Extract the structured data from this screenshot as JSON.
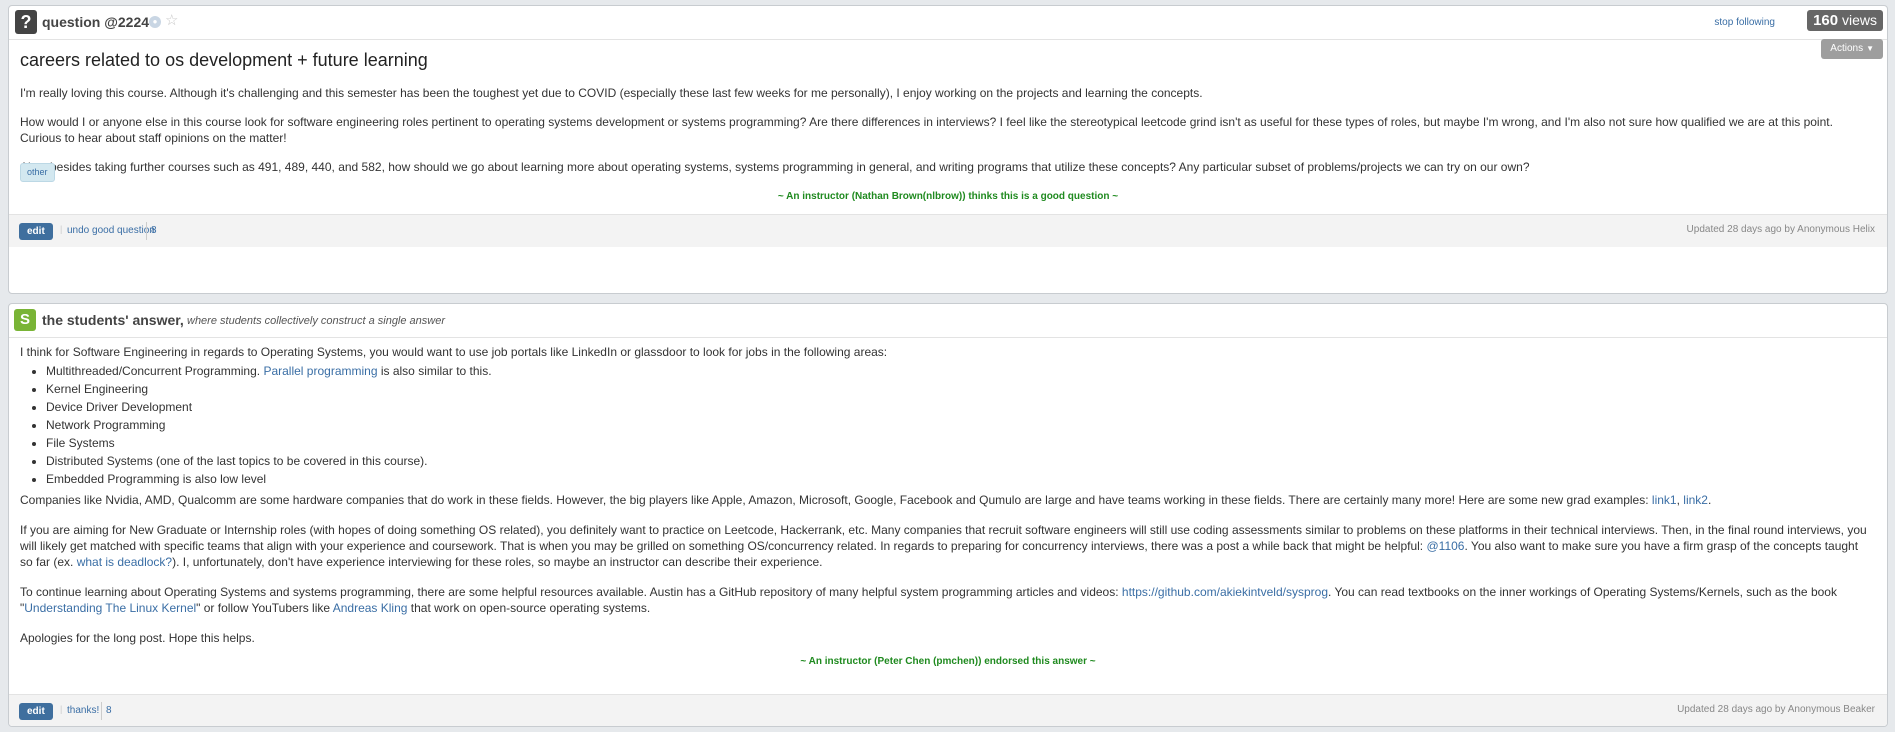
{
  "question": {
    "header": {
      "label": "question @2224",
      "follow": "stop following",
      "views_count": "160",
      "views_label": "views",
      "actions": "Actions"
    },
    "title": "careers related to os development + future learning",
    "paragraphs": [
      "I'm really loving this course. Although it's challenging and this semester has been the toughest yet due to COVID (especially these last few weeks for me personally), I enjoy working on the projects and learning the concepts.",
      "How would I or anyone else in this course look for software engineering roles pertinent to operating systems development or systems programming? Are there differences in interviews? I feel like the stereotypical leetcode grind isn't as useful for these types of roles, but maybe I'm wrong, and I'm also not sure how qualified we are at this point. Curious to hear about staff opinions on the matter!",
      "Also, besides taking further courses such as 491, 489, 440, and 582, how should we go about learning more about operating systems, systems programming in general, and writing programs that utilize these concepts? Any particular subset of problems/projects we can try on our own?"
    ],
    "tag": "other",
    "endorsement": "~ An instructor (Nathan Brown(nlbrow)) thinks this is a good question ~",
    "footer": {
      "edit": "edit",
      "good_question": "undo good question",
      "count": "8",
      "updated": "Updated 28 days ago by Anonymous Helix"
    }
  },
  "answer": {
    "header": {
      "icon": "S",
      "title": "the students' answer,",
      "subtitle": "where students collectively construct a single answer"
    },
    "intro": "I think for Software Engineering in regards to Operating Systems, you would want to use job portals like LinkedIn or glassdoor to look for jobs in the following areas:",
    "list": {
      "item1_prefix": "Multithreaded/Concurrent Programming.",
      "item1_link": "Parallel programming",
      "item1_suffix": "is also similar to this.",
      "items": [
        "Kernel Engineering",
        "Device Driver Development",
        "Network Programming",
        "File Systems",
        "Distributed Systems (one of the last topics to be covered in this course).",
        "Embedded Programming is also low level"
      ]
    },
    "p2": {
      "text": "Companies like Nvidia, AMD, Qualcomm are some hardware companies that do work in these fields. However, the big players like Apple, Amazon, Microsoft, Google, Facebook and Qumulo are large and have teams working in these fields. There are certainly many more! Here are some new grad examples:",
      "link1": "link1",
      "comma": ",",
      "link2": "link2",
      "end": "."
    },
    "p3": {
      "text1": "If you are aiming for New Graduate or Internship roles (with hopes of doing something OS related), you definitely want to practice on Leetcode, Hackerrank, etc. Many companies that recruit software engineers will still use coding assessments similar to problems on these platforms in their technical interviews. Then, in the final round interviews, you will likely get matched with specific teams that align with your experience and coursework. That is when you may be grilled on something OS/concurrency related. In regards to preparing for concurrency interviews, there was a post a while back that might be helpful:",
      "post_link": "@1106",
      "text2": ". You also want to make sure you have a firm grasp of the concepts taught so far (ex.",
      "deadlock_link": "what is deadlock?",
      "text3": "). I, unfortunately, don't have experience interviewing for these roles, so maybe an instructor can describe their experience."
    },
    "p4": {
      "text1": "To continue learning about Operating Systems and systems programming, there are some helpful resources available. Austin has a GitHub repository of many helpful system programming articles and videos:",
      "github_link": "https://github.com/akiekintveld/sysprog",
      "text2": ". You can read textbooks on the inner workings of Operating Systems/Kernels, such as the book \"",
      "book_link": "Understanding The Linux Kernel",
      "text3": "\" or follow YouTubers like",
      "yt_link": "Andreas Kling",
      "text4": "that work on open-source operating systems."
    },
    "p5": "Apologies for the long post. Hope this helps.",
    "endorsement": "~ An instructor (Peter Chen (pmchen)) endorsed this answer ~",
    "footer": {
      "edit": "edit",
      "thanks": "thanks!",
      "count": "8",
      "updated": "Updated 28 days ago by Anonymous Beaker"
    }
  }
}
